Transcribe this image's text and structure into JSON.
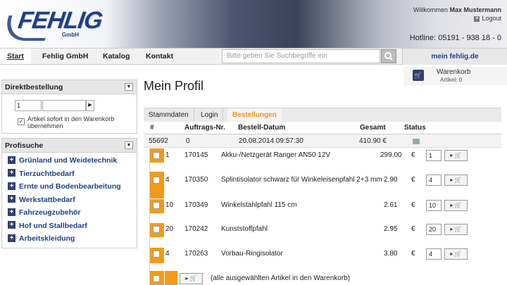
{
  "brand": {
    "name": "FEHLIG",
    "suffix": "GmbH"
  },
  "user": {
    "welcome": "Willkommen",
    "name": "Max Mustermann",
    "logout": "Logout"
  },
  "hotline": "Hotline: 05191 - 938 18 - 0",
  "nav": {
    "items": [
      "Start",
      "Fehlig GmbH",
      "Katalog",
      "Kontakt"
    ]
  },
  "search": {
    "placeholder": "Bitte geben Sie Suchbegriffe ein"
  },
  "account": {
    "label": "mein fehlig.de"
  },
  "cart": {
    "label": "Warenkorb",
    "count": "Artikel: 0"
  },
  "direkt": {
    "title": "Direktbestellung",
    "qty": "1",
    "checkbox_label": "Artikel sofort in den Warenkorb übernehmen",
    "checked": true
  },
  "profi": {
    "title": "Profisuche",
    "categories": [
      "Grünland und Weidetechnik",
      "Tierzuchtbedarf",
      "Ernte und Bodenbearbeitung",
      "Werkstattbedarf",
      "Fahrzeugzubehör",
      "Hof und Stallbedarf",
      "Arbeitskleidung"
    ]
  },
  "page": {
    "title": "Mein Profil"
  },
  "tabs": [
    "Stammdaten",
    "Login",
    "Bestellungen"
  ],
  "orders": {
    "headers": [
      "#",
      "Auftrags-Nr.",
      "Bestell-Datum",
      "Gesamt",
      "Status"
    ],
    "row": {
      "id": "55692",
      "auftrag": "0",
      "datum": "20.08.2014 09:57:30",
      "gesamt": "410.90 €"
    },
    "items": [
      {
        "qty": "1",
        "nr": "170145",
        "name": "Akku-/Netzgerät Ranger AN50 12V",
        "price": "299.00",
        "cur": "€",
        "input": "1"
      },
      {
        "qty": "4",
        "nr": "170350",
        "name": "Splintisolator schwarz für Winkeleisenpfahl 2+3 mm",
        "price": "2.90",
        "cur": "€",
        "input": "4"
      },
      {
        "qty": "10",
        "nr": "170349",
        "name": "Winkelstahlpfahl 115 cm",
        "price": "2.61",
        "cur": "€",
        "input": "10"
      },
      {
        "qty": "20",
        "nr": "170242",
        "name": "Kunststoffpfahl",
        "price": "2.95",
        "cur": "€",
        "input": "20"
      },
      {
        "qty": "4",
        "nr": "170263",
        "name": "Vorbau-Ringisolator",
        "price": "3.80",
        "cur": "€",
        "input": "4"
      }
    ],
    "all_label": "(alle ausgewählten Artikel in den Warenkorb)"
  },
  "icons": {
    "cart": "cart-icon",
    "search": "search-icon",
    "plus": "plus-icon",
    "dropdown": "chevron-down-icon",
    "close": "close-icon",
    "arrow": "arrow-right-icon"
  }
}
